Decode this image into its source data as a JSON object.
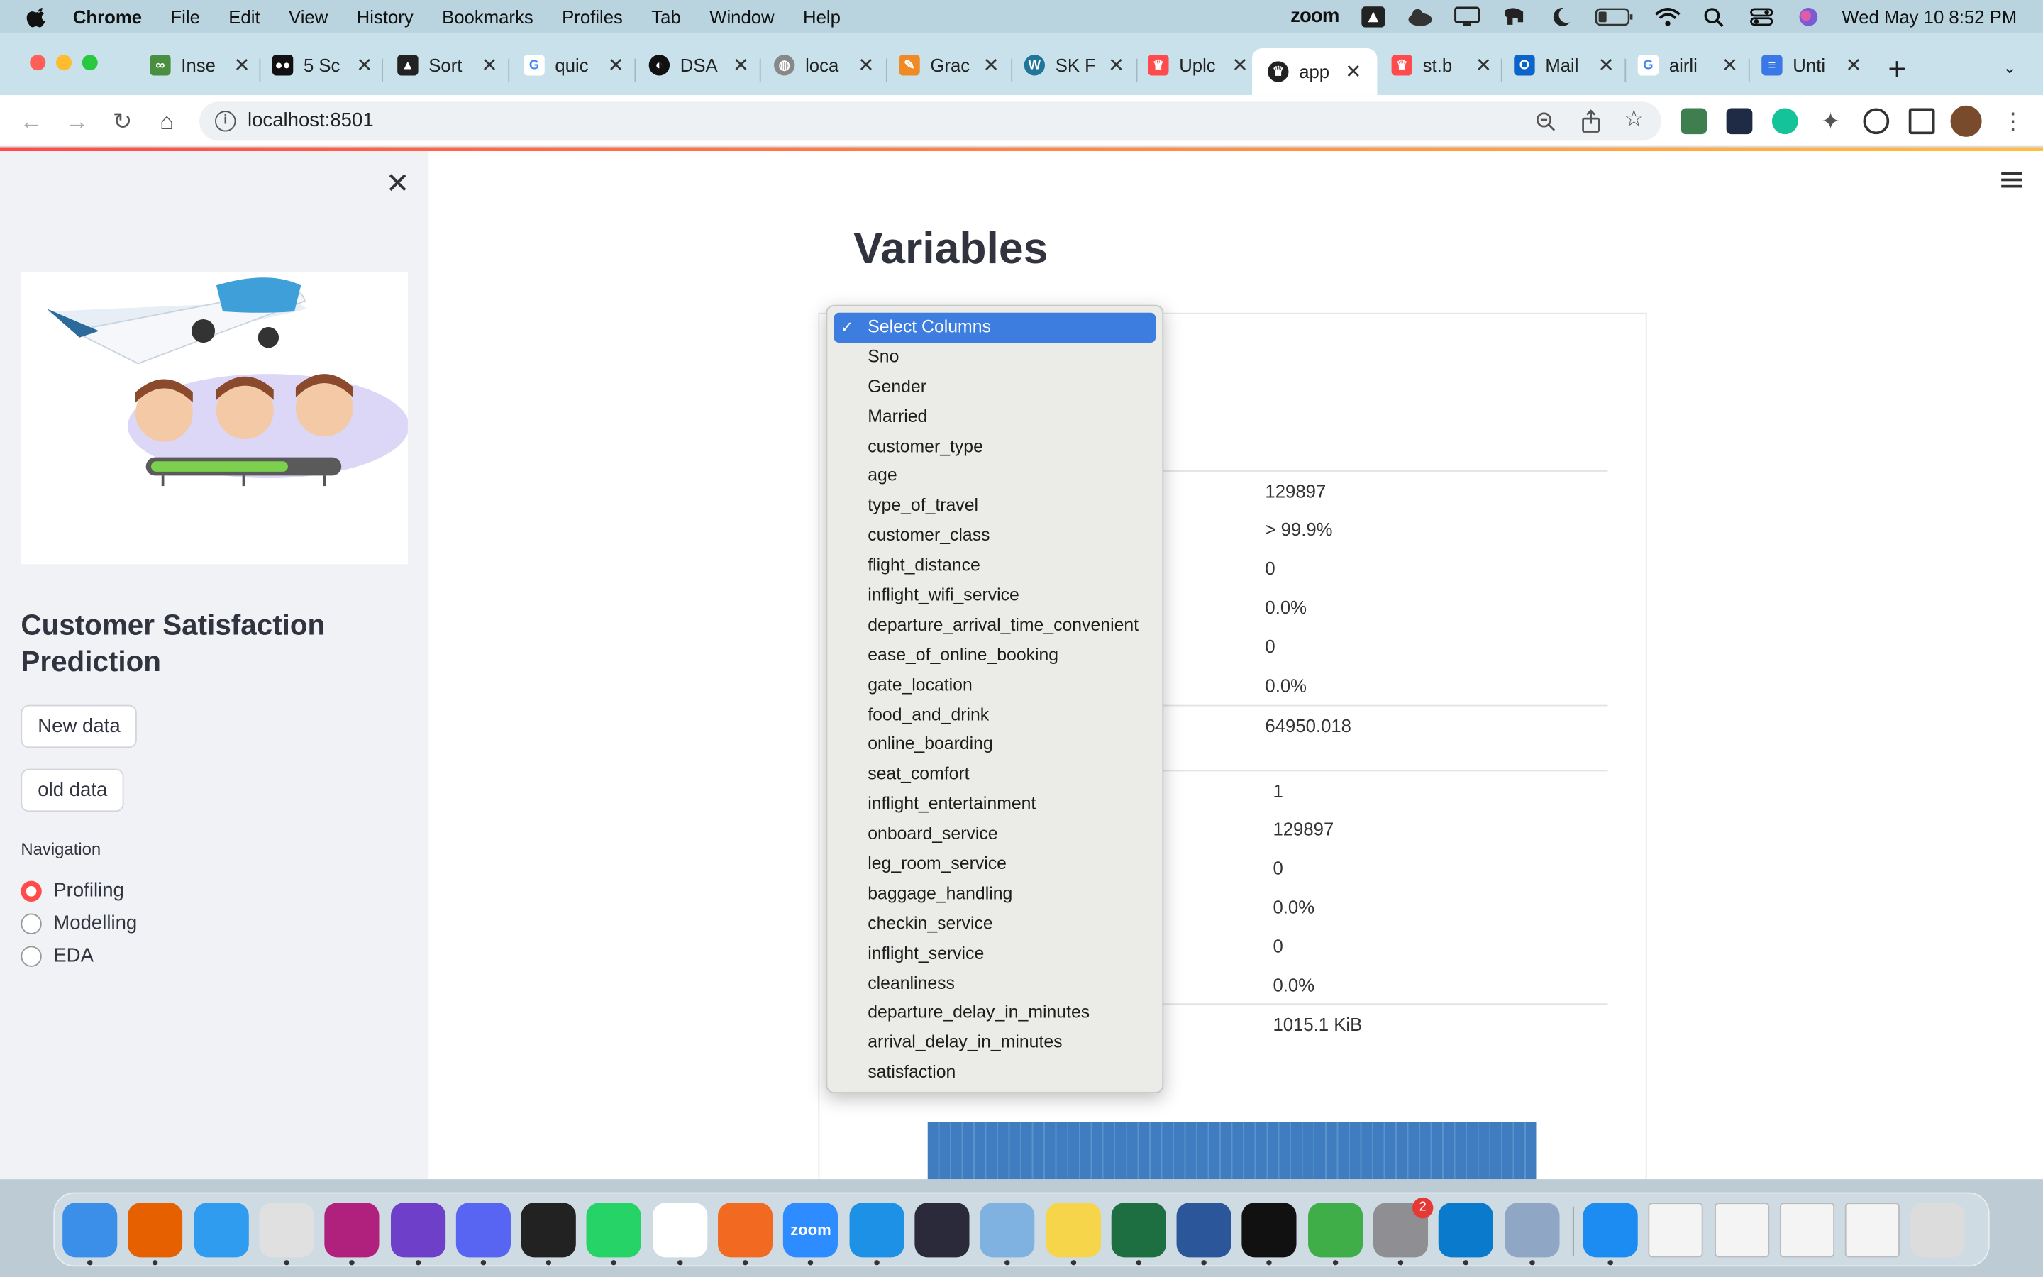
{
  "menubar": {
    "app_name": "Chrome",
    "items": [
      "File",
      "Edit",
      "View",
      "History",
      "Bookmarks",
      "Profiles",
      "Tab",
      "Window",
      "Help"
    ],
    "zoom_label": "zoom",
    "datetime": "Wed May 10  8:52 PM"
  },
  "tabs": [
    {
      "label": "Inse",
      "icon": "ai-icon",
      "color": "#4a8f3f"
    },
    {
      "label": "5 Sc",
      "icon": "medium-icon",
      "color": "#111111"
    },
    {
      "label": "Sort",
      "icon": "vercel-icon",
      "color": "#222222"
    },
    {
      "label": "quic",
      "icon": "google-icon",
      "color": "#4285f4"
    },
    {
      "label": "DSA",
      "icon": "github-icon",
      "color": "#111111"
    },
    {
      "label": "loca",
      "icon": "globe-icon",
      "color": "#777777"
    },
    {
      "label": "Grac",
      "icon": "pencil-icon",
      "color": "#f08a24"
    },
    {
      "label": "SK F",
      "icon": "wordpress-icon",
      "color": "#21759b"
    },
    {
      "label": "Uplc",
      "icon": "streamlit-icon",
      "color": "#ff4b4b"
    },
    {
      "label": "app",
      "icon": "streamlit-icon",
      "color": "#222222",
      "active": true
    },
    {
      "label": "st.b",
      "icon": "streamlit-icon",
      "color": "#ff4b4b"
    },
    {
      "label": "Mail",
      "icon": "outlook-icon",
      "color": "#0a64c9"
    },
    {
      "label": "airli",
      "icon": "google-icon",
      "color": "#4285f4"
    },
    {
      "label": "Unti",
      "icon": "docs-icon",
      "color": "#3b78e7"
    }
  ],
  "address": {
    "url": "localhost:8501"
  },
  "sidebar": {
    "title": "Customer Satisfaction Prediction",
    "new_data_label": "New data",
    "old_data_label": "old data",
    "navigation_label": "Navigation",
    "nav_options": [
      {
        "label": "Profiling",
        "selected": true
      },
      {
        "label": "Modelling",
        "selected": false
      },
      {
        "label": "EDA",
        "selected": false
      }
    ]
  },
  "main": {
    "heading": "Variables",
    "stats": [
      "129897",
      "> 99.9%",
      "0",
      "0.0%",
      "0",
      "0.0%",
      "64950.018",
      "1",
      "129897",
      "0",
      "0.0%",
      "0",
      "0.0%",
      "1015.1 KiB"
    ]
  },
  "dropdown": {
    "selected": "Select Columns",
    "options": [
      "Sno",
      "Gender",
      "Married",
      "customer_type",
      "age",
      "type_of_travel",
      "customer_class",
      "flight_distance",
      "inflight_wifi_service",
      "departure_arrival_time_convenient",
      "ease_of_online_booking",
      "gate_location",
      "food_and_drink",
      "online_boarding",
      "seat_comfort",
      "inflight_entertainment",
      "onboard_service",
      "leg_room_service",
      "baggage_handling",
      "checkin_service",
      "inflight_service",
      "cleanliness",
      "departure_delay_in_minutes",
      "arrival_delay_in_minutes",
      "satisfaction"
    ]
  },
  "dock": {
    "badge_count": "2",
    "zoom_app_label": "zoom",
    "apps": [
      {
        "name": "finder-icon",
        "color": "#3b8fe8"
      },
      {
        "name": "firefox-icon",
        "color": "#e66000"
      },
      {
        "name": "safari-icon",
        "color": "#2f9cf0"
      },
      {
        "name": "chrome-icon",
        "color": "#e0e0e0"
      },
      {
        "name": "intellij-icon",
        "color": "#b0217e"
      },
      {
        "name": "github-desktop-icon",
        "color": "#6e40c9"
      },
      {
        "name": "discord-icon",
        "color": "#5865f2"
      },
      {
        "name": "terminal-icon",
        "color": "#222222"
      },
      {
        "name": "whatsapp-icon",
        "color": "#25d366"
      },
      {
        "name": "slack-icon",
        "color": "#ffffff"
      },
      {
        "name": "pencil-app-icon",
        "color": "#f26a21"
      },
      {
        "name": "zoom-icon",
        "color": "#2d8cff"
      },
      {
        "name": "docker-icon",
        "color": "#1d91e6"
      },
      {
        "name": "screen-app-icon",
        "color": "#2a2a3a"
      },
      {
        "name": "instruments-icon",
        "color": "#7fb2e0"
      },
      {
        "name": "notes-icon",
        "color": "#f7d54a"
      },
      {
        "name": "excel-icon",
        "color": "#1d6f42"
      },
      {
        "name": "word-icon",
        "color": "#2b579a"
      },
      {
        "name": "pycharm-icon",
        "color": "#111111"
      },
      {
        "name": "circle-app-icon",
        "color": "#3fae49"
      },
      {
        "name": "system-settings-icon",
        "color": "#8e8e93"
      },
      {
        "name": "vscode-icon",
        "color": "#0a7acc"
      },
      {
        "name": "preview-icon",
        "color": "#8fa7c4"
      },
      {
        "name": "app-store-icon",
        "color": "#1c8cf2"
      },
      {
        "name": "document-thumb-icon",
        "color": "#f4f4f4"
      },
      {
        "name": "document-thumb-icon",
        "color": "#f4f4f4"
      },
      {
        "name": "document-thumb-icon",
        "color": "#f4f4f4"
      },
      {
        "name": "document-thumb-icon",
        "color": "#f4f4f4"
      },
      {
        "name": "trash-icon",
        "color": "#dcdcdc"
      }
    ]
  }
}
